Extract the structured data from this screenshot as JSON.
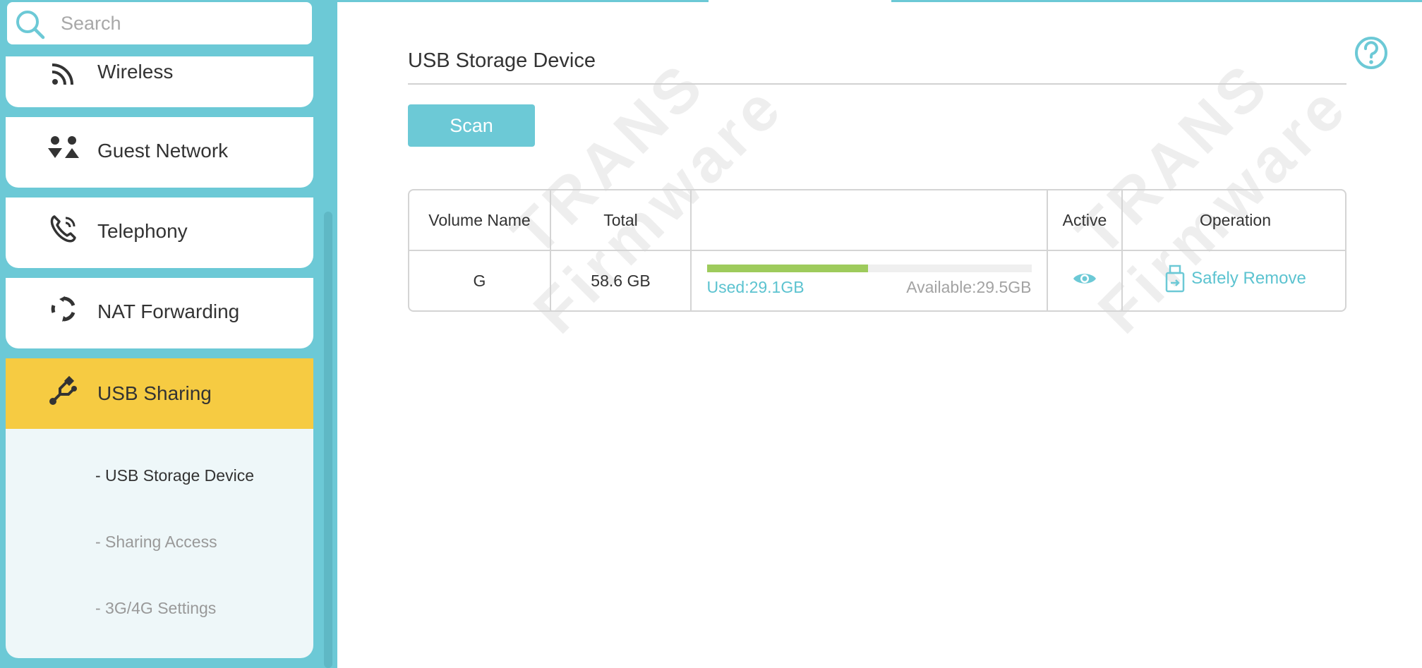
{
  "search": {
    "placeholder": "Search"
  },
  "sidebar": {
    "items": [
      {
        "label": "Wireless",
        "icon": "wireless-icon"
      },
      {
        "label": "Guest Network",
        "icon": "guest-network-icon"
      },
      {
        "label": "Telephony",
        "icon": "telephony-icon"
      },
      {
        "label": "NAT Forwarding",
        "icon": "nat-forwarding-icon"
      },
      {
        "label": "USB Sharing",
        "icon": "usb-icon",
        "active": true
      }
    ],
    "subitems": [
      {
        "label": "- USB Storage Device",
        "current": true
      },
      {
        "label": "- Sharing Access"
      },
      {
        "label": "- 3G/4G Settings"
      }
    ]
  },
  "watermark": {
    "line1": "TRANS",
    "line2": "Firmware"
  },
  "main": {
    "title": "USB Storage Device",
    "scan_label": "Scan",
    "table": {
      "headers": {
        "volume": "Volume Name",
        "total": "Total",
        "usage": "",
        "active": "Active",
        "operation": "Operation"
      },
      "rows": [
        {
          "volume": "G",
          "total": "58.6 GB",
          "used": "Used:29.1GB",
          "available": "Available:29.5GB",
          "used_fraction": 0.497,
          "active_icon": "eye-icon",
          "operation": "Safely Remove"
        }
      ]
    }
  },
  "colors": {
    "accent": "#6cc9d6",
    "active_menu": "#f6cb42",
    "usage_fill": "#9ecb5c",
    "link": "#5cc3d0"
  }
}
